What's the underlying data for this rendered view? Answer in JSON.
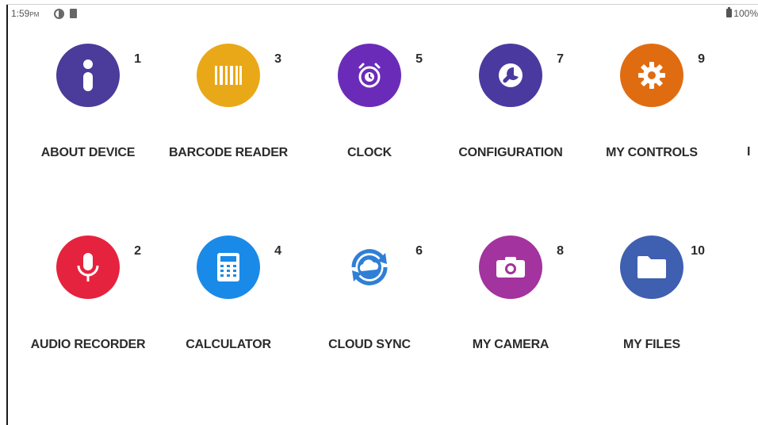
{
  "status_bar": {
    "time": "1:59",
    "ampm": "PM",
    "battery": "100%",
    "icons": [
      "sync-icon",
      "sd-card-icon",
      "battery-icon"
    ]
  },
  "apps": [
    {
      "id": "about-device",
      "label": "ABOUT DEVICE",
      "number": "1",
      "icon": "info-icon",
      "color": "#4b3b9a"
    },
    {
      "id": "barcode-reader",
      "label": "BARCODE READER",
      "number": "3",
      "icon": "barcode-icon",
      "color": "#e9a817"
    },
    {
      "id": "clock",
      "label": "CLOCK",
      "number": "5",
      "icon": "alarm-clock-icon",
      "color": "#6a2cb8"
    },
    {
      "id": "configuration",
      "label": "CONFIGURATION",
      "number": "7",
      "icon": "wrench-icon",
      "color": "#4a3aa0"
    },
    {
      "id": "my-controls",
      "label": "MY CONTROLS",
      "number": "9",
      "icon": "gear-icon",
      "color": "#e06c12"
    },
    {
      "id": "audio-recorder",
      "label": "AUDIO RECORDER",
      "number": "2",
      "icon": "microphone-icon",
      "color": "#e5233e"
    },
    {
      "id": "calculator",
      "label": "CALCULATOR",
      "number": "4",
      "icon": "calculator-icon",
      "color": "#1a8ae8"
    },
    {
      "id": "cloud-sync",
      "label": "CLOUD SYNC",
      "number": "6",
      "icon": "cloud-sync-icon",
      "color": "#2f7fd6"
    },
    {
      "id": "my-camera",
      "label": "MY CAMERA",
      "number": "8",
      "icon": "camera-icon",
      "color": "#a3339e"
    },
    {
      "id": "my-files",
      "label": "MY FILES",
      "number": "10",
      "icon": "folder-icon",
      "color": "#3f5fb0"
    }
  ],
  "edge_partial_label": "I"
}
